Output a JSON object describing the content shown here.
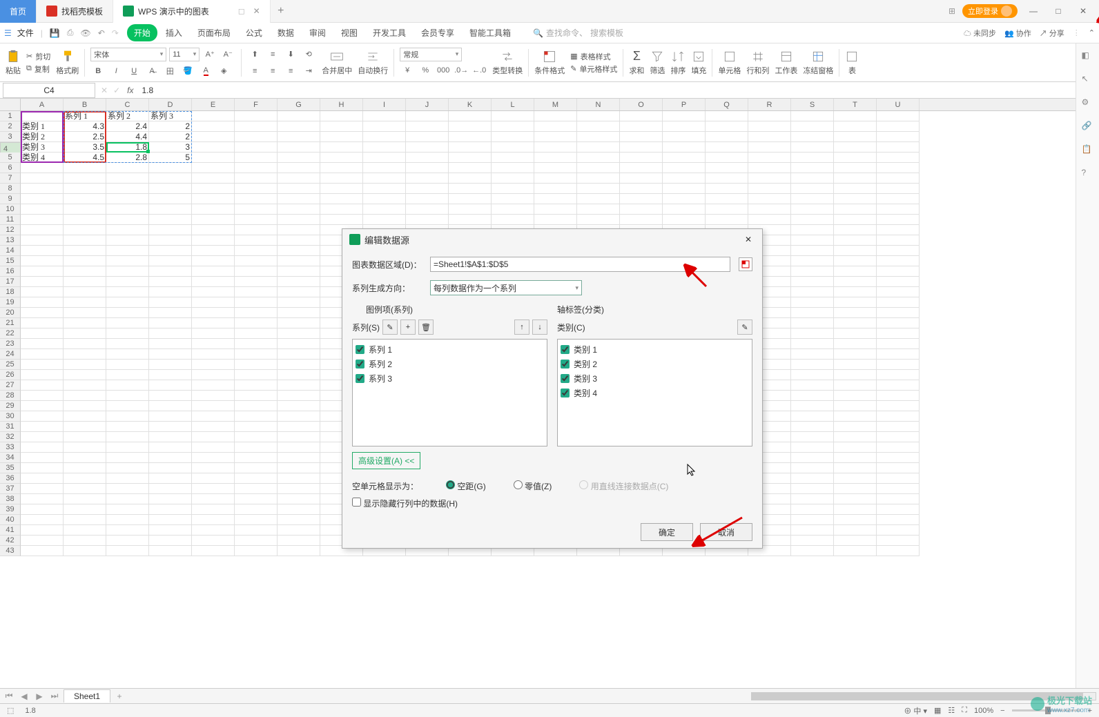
{
  "tabs": {
    "home": "首页",
    "templates": "找稻壳模板",
    "doc": "WPS 演示中的图表"
  },
  "login_btn": "立即登录",
  "file_menu": "文件",
  "menu": {
    "start": "开始",
    "insert": "插入",
    "layout": "页面布局",
    "formula": "公式",
    "data": "数据",
    "review": "审阅",
    "view": "视图",
    "dev": "开发工具",
    "vip": "会员专享",
    "smart": "智能工具箱"
  },
  "search_hint1": "查找命令、",
  "search_hint2": "搜索模板",
  "sync": "未同步",
  "collab": "协作",
  "share": "分享",
  "toolbar": {
    "paste": "粘贴",
    "cut": "剪切",
    "copy": "复制",
    "fmt": "格式刷",
    "font": "宋体",
    "size": "11",
    "merge": "合并居中",
    "wrap": "自动换行",
    "general": "常规",
    "type_convert": "类型转换",
    "cond_fmt": "条件格式",
    "table_style": "表格样式",
    "cell_style": "单元格样式",
    "sum": "求和",
    "filter": "筛选",
    "sort": "排序",
    "fill": "填充",
    "cell": "单元格",
    "rowcol": "行和列",
    "sheet": "工作表",
    "freeze": "冻结窗格",
    "more": "表"
  },
  "name_box": "C4",
  "formula": "1.8",
  "cols": [
    "A",
    "B",
    "C",
    "D",
    "E",
    "F",
    "G",
    "H",
    "I",
    "J",
    "K",
    "L",
    "M",
    "N",
    "O",
    "P",
    "Q",
    "R",
    "S",
    "T",
    "U"
  ],
  "grid": {
    "b1": "系列 1",
    "c1": "系列 2",
    "d1": "系列 3",
    "a2": "类别 1",
    "b2": "4.3",
    "c2": "2.4",
    "d2": "2",
    "a3": "类别 2",
    "b3": "2.5",
    "c3": "4.4",
    "d3": "2",
    "a4": "类别 3",
    "b4": "3.5",
    "c4": "1.8",
    "d4": "3",
    "a5": "类别 4",
    "b5": "4.5",
    "c5": "2.8",
    "d5": "5"
  },
  "dialog": {
    "title": "编辑数据源",
    "range_label": "图表数据区域(D)：",
    "range_value": "=Sheet1!$A$1:$D$5",
    "series_dir_label": "系列生成方向：",
    "series_dir_value": "每列数据作为一个系列",
    "legend_hdr": "图例项(系列)",
    "axis_hdr": "轴标签(分类)",
    "series_label": "系列(S)",
    "category_label": "类别(C)",
    "series": [
      "系列 1",
      "系列 2",
      "系列 3"
    ],
    "categories": [
      "类别 1",
      "类别 2",
      "类别 3",
      "类别 4"
    ],
    "advanced": "高级设置(A) <<",
    "empty_label": "空单元格显示为：",
    "gap": "空距(G)",
    "zero": "零值(Z)",
    "line": "用直线连接数据点(C)",
    "show_hidden": "显示隐藏行列中的数据(H)",
    "ok": "确定",
    "cancel": "取消"
  },
  "sheet_tab": "Sheet1",
  "status_left": "1.8",
  "ime": "中",
  "zoom": "100%",
  "watermark": {
    "name": "极光下载站",
    "url": "www.xz7.com"
  }
}
